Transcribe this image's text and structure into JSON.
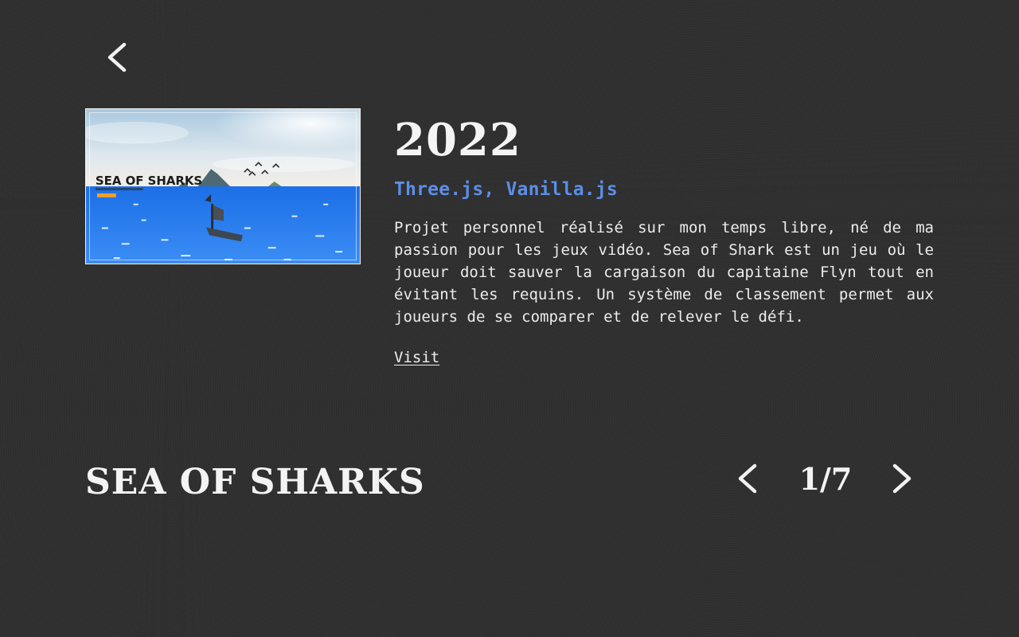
{
  "navigation": {
    "back_icon": "chevron-left-icon"
  },
  "project": {
    "thumbnail": {
      "logo_text": "SEA OF SHARKS"
    },
    "year": "2022",
    "technologies": "Three.js, Vanilla.js",
    "description": "Projet personnel réalisé sur mon temps libre, né de ma passion pour les jeux vidéo. Sea of Shark est un jeu où le joueur doit sauver la cargaison du capitaine Flyn tout en évitant les requins. Un système de classement permet aux joueurs de se comparer et de relever le défi.",
    "visit_label": "Visit",
    "title": "SEA OF SHARKS"
  },
  "pager": {
    "counter": "1/7",
    "prev_icon": "chevron-left-icon",
    "next_icon": "chevron-right-icon"
  },
  "colors": {
    "background": "#2c2c2c",
    "text": "#f1f1f1",
    "accent": "#5b8ee6"
  }
}
